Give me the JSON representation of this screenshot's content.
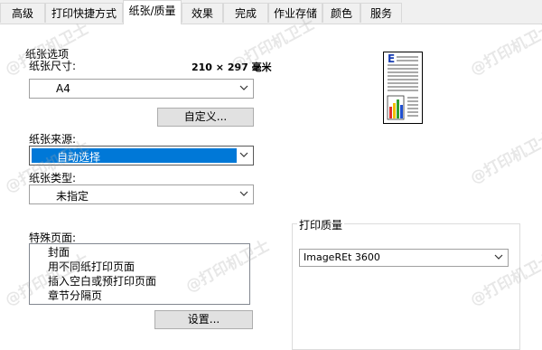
{
  "tabs": [
    {
      "label": "高级",
      "active": false
    },
    {
      "label": "打印快捷方式",
      "active": false
    },
    {
      "label": "纸张/质量",
      "active": true
    },
    {
      "label": "效果",
      "active": false
    },
    {
      "label": "完成",
      "active": false
    },
    {
      "label": "作业存储",
      "active": false
    },
    {
      "label": "颜色",
      "active": false
    },
    {
      "label": "服务",
      "active": false
    }
  ],
  "paper_options": {
    "group_title": "纸张选项",
    "size_label": "纸张尺寸:",
    "size_dimensions": "210 × 297 毫米",
    "size_value": "A4",
    "custom_button": "自定义...",
    "source_label": "纸张来源:",
    "source_value": "自动选择",
    "type_label": "纸张类型:",
    "type_value": "未指定"
  },
  "special_pages": {
    "label": "特殊页面:",
    "items": [
      "封面",
      "用不同纸打印页面",
      "插入空白或预打印页面",
      "章节分隔页"
    ],
    "settings_button": "设置..."
  },
  "print_quality": {
    "group_title": "打印质量",
    "value": "ImageREt 3600"
  },
  "watermark": {
    "text": "@打印机卫士"
  },
  "preview": {
    "letter": "E"
  },
  "colors": {
    "accent": "#0078d7"
  }
}
